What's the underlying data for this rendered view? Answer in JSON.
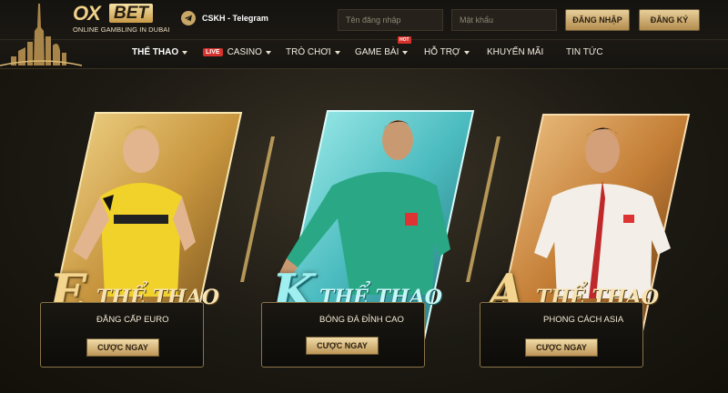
{
  "header": {
    "logo_ox": "OX",
    "logo_bet": "BET",
    "logo_tagline": "ONLINE GAMBLING IN DUBAI",
    "support_label": "CSKH - Telegram",
    "username_placeholder": "Tên đăng nhập",
    "password_placeholder": "Mật khẩu",
    "login_label": "ĐĂNG NHẬP",
    "register_label": "ĐĂNG KÝ"
  },
  "nav": {
    "items": [
      {
        "label": "THỂ THAO",
        "has_caret": true
      },
      {
        "badge": "LIVE",
        "label": "CASINO",
        "has_caret": true
      },
      {
        "label": "TRÒ CHƠI",
        "has_caret": true
      },
      {
        "label": "GAME BÀI",
        "has_caret": true,
        "badge_top": "HOT"
      },
      {
        "label": "HỖ TRỢ",
        "has_caret": true
      },
      {
        "label": "KHUYẾN MÃI",
        "has_caret": false
      },
      {
        "label": "TIN TỨC",
        "has_caret": false
      }
    ]
  },
  "cards": [
    {
      "letter": "E",
      "title": "THỂ THAO",
      "subtitle": "ĐẲNG CẤP EURO",
      "button": "CƯỢC NGAY"
    },
    {
      "letter": "K",
      "title": "THỂ THAO",
      "subtitle": "BÓNG ĐÁ ĐỈNH CAO",
      "button": "CƯỢC NGAY"
    },
    {
      "letter": "A",
      "title": "THỂ THAO",
      "subtitle": "PHONG CÁCH ASIA",
      "button": "CƯỢC NGAY"
    }
  ],
  "colors": {
    "gold": "#c9a766",
    "teal": "#5fd1d1",
    "live_red": "#d4322d"
  }
}
